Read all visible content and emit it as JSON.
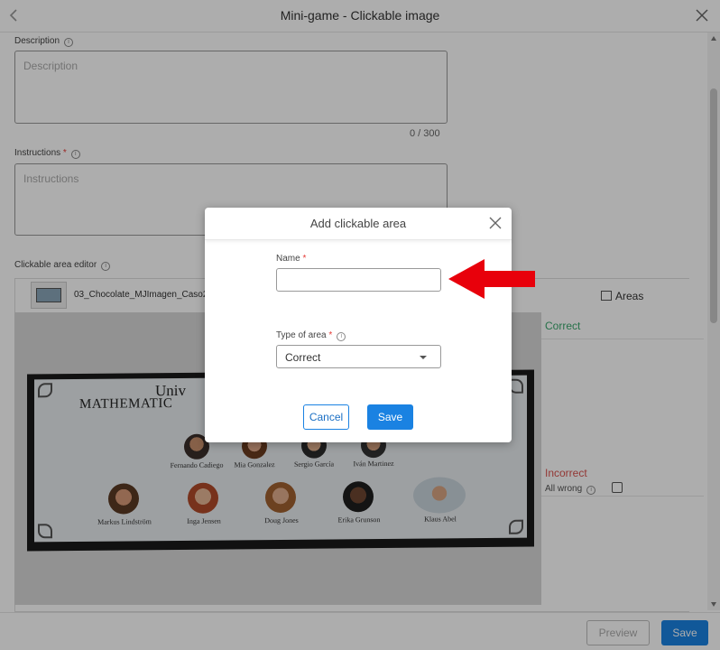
{
  "header": {
    "back_icon": "chevron-left-icon",
    "title": "Mini-game - Clickable image",
    "close_icon": "close-icon"
  },
  "form": {
    "description": {
      "label": "Description",
      "placeholder": "Description",
      "counter": "0 / 300"
    },
    "instructions": {
      "label": "Instructions",
      "required_mark": "*",
      "placeholder": "Instructions"
    },
    "editor": {
      "label": "Clickable area editor",
      "file_name": "03_Chocolate_MJImagen_Caso2"
    }
  },
  "image_content": {
    "title_line1": "Univ",
    "title_line2": "MATHEMATIC",
    "people_row1": [
      "Fernando Cadiego",
      "Mia Gonzalez",
      "Sergio García",
      "Iván Martinez"
    ],
    "people_row2": [
      "Markus Lindström",
      "Inga Jensen",
      "Doug Jones",
      "Erika Grunson",
      "Klaus Abel"
    ]
  },
  "areas_panel": {
    "header": "Areas",
    "correct_label": "Correct",
    "incorrect_label": "Incorrect",
    "all_wrong_label": "All wrong"
  },
  "footer": {
    "preview_label": "Preview",
    "save_label": "Save"
  },
  "modal": {
    "title": "Add clickable area",
    "name_label": "Name",
    "name_required": "*",
    "name_value": "",
    "type_label": "Type of area",
    "type_required": "*",
    "type_selected": "Correct",
    "cancel_label": "Cancel",
    "save_label": "Save"
  },
  "colors": {
    "primary": "#1a82e2",
    "correct": "#3aa76d",
    "incorrect": "#d9534f",
    "annotation_arrow": "#e8000b"
  }
}
